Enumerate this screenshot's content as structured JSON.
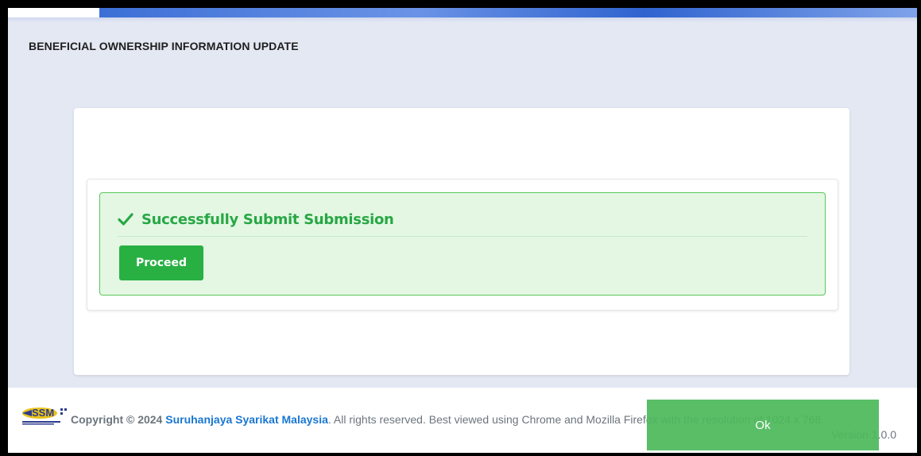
{
  "page": {
    "title": "BENEFICIAL OWNERSHIP INFORMATION UPDATE"
  },
  "alert": {
    "message": "Successfully Submit Submission",
    "icon": "check-icon",
    "button_label": "Proceed",
    "color": "#28a745",
    "background": "#e3f7e3"
  },
  "footer": {
    "copyright_prefix": "Copyright © 2024",
    "brand": "Suruhanjaya Syarikat Malaysia",
    "rights": ". All rights reserved. Best viewed using Chrome and Mozilla Firefox with the resolution of 1024 x 768.",
    "version": "Version 1.0.0",
    "logo_text": "SSM"
  },
  "toast": {
    "button_label": "Ok"
  }
}
